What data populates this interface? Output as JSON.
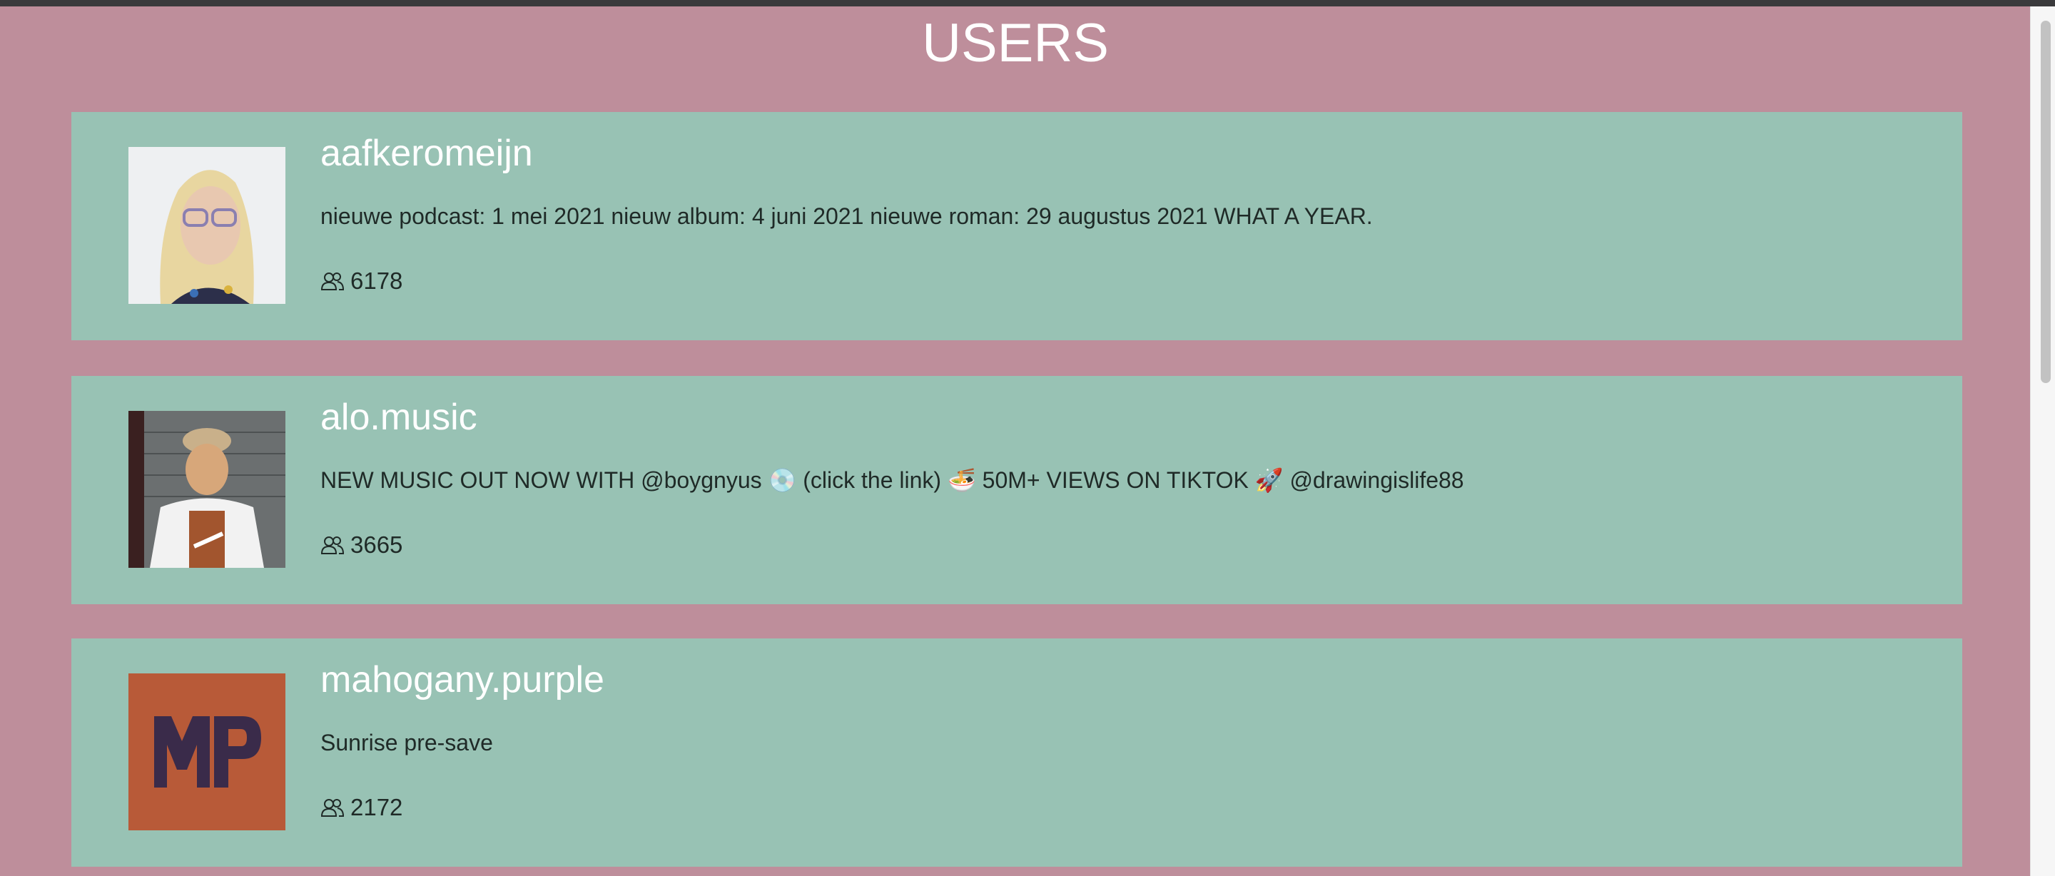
{
  "page": {
    "title": "USERS"
  },
  "colors": {
    "background": "#be8e9b",
    "card": "#98c2b4",
    "title": "#ffffff",
    "username": "#ffffff",
    "text": "#1f2a27"
  },
  "users": [
    {
      "username": "aafkeromeijn",
      "bio": "nieuwe podcast: 1 mei 2021 nieuw album: 4 juni 2021 nieuwe roman: 29 augustus 2021 WHAT A YEAR.",
      "followers": "6178",
      "avatar": "portrait-blonde-glasses"
    },
    {
      "username": "alo.music",
      "bio": "NEW MUSIC OUT NOW WITH @boygnyus 💿 (click the link) 🍜 50M+ VIEWS ON TIKTOK 🚀 @drawingislife88",
      "followers": "3665",
      "avatar": "portrait-cap-smiling"
    },
    {
      "username": "mahogany.purple",
      "bio": "Sunrise pre-save",
      "followers": "2172",
      "avatar": "mp-logo"
    }
  ],
  "icons": {
    "followers": "people-icon"
  }
}
